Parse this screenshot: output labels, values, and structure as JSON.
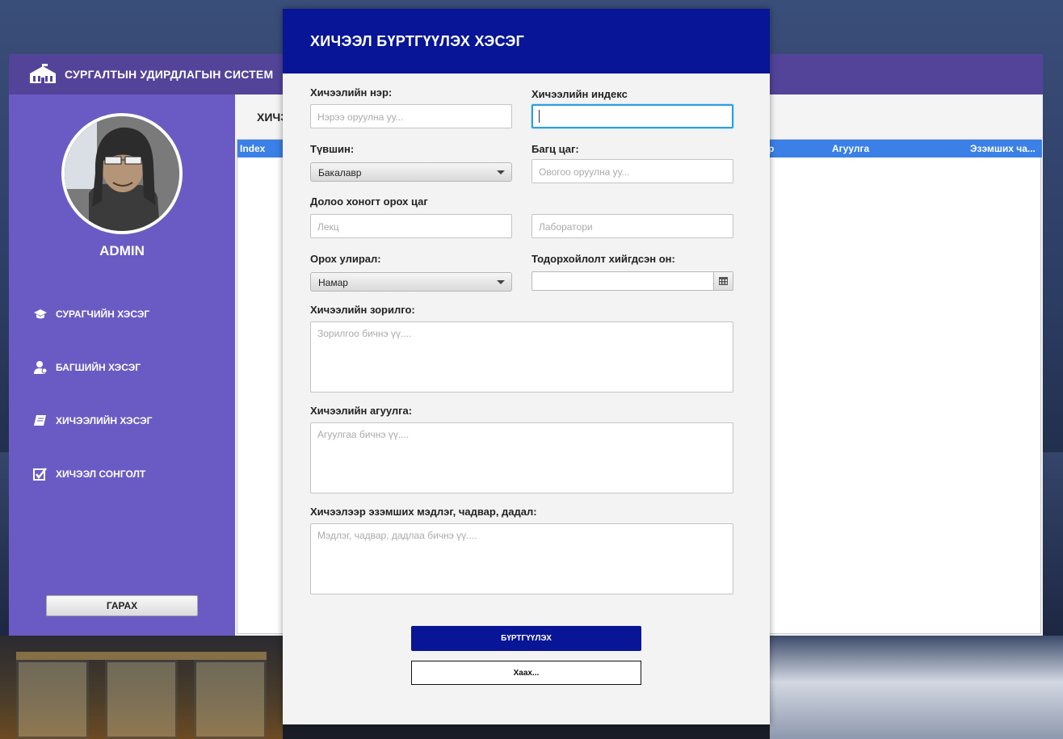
{
  "app": {
    "title": "СУРГАЛТЫН УДИРДЛАГЫН СИСТЕМ",
    "logo_icon": "school-building-icon"
  },
  "sidebar": {
    "user_name": "ADMIN",
    "items": [
      {
        "label": "СУРАГЧИЙН ХЭСЭГ",
        "icon": "graduation-cap-icon"
      },
      {
        "label": "БАГШИЙН ХЭСЭГ",
        "icon": "user-icon"
      },
      {
        "label": "ХИЧЭЭЛИЙН ХЭСЭГ",
        "icon": "book-icon"
      },
      {
        "label": "ХИЧЭЭЛ СОНГОЛТ",
        "icon": "checkbox-icon"
      }
    ],
    "logout_label": "ГАРАХ"
  },
  "content": {
    "title_visible": "ХИЧЭ",
    "table_headers": [
      "Index",
      "р",
      "Агуулга",
      "Эзэмших ча..."
    ]
  },
  "dialog": {
    "title": "ХИЧЭЭЛ БҮРТГҮҮЛЭХ ХЭСЭГ",
    "course_name_label": "Хичээлийн нэр:",
    "course_name_placeholder": "Нэрээ оруулна уу...",
    "course_index_label": "Хичээлийн индекс",
    "course_index_value": "",
    "level_label": "Түвшин:",
    "level_value": "Бакалавр",
    "credit_label": "Багц цаг:",
    "credit_placeholder": "Овогоо оруулна уу...",
    "weekly_hours_label": "Долоо хоногт орох цаг",
    "lecture_placeholder": "Лекц",
    "lab_placeholder": "Лаборатори",
    "semester_label": "Орох улирал:",
    "semester_value": "Намар",
    "year_label": "Тодорхойлолт хийгдсэн он:",
    "year_value": "",
    "objective_label": "Хичээлийн зорилго:",
    "objective_placeholder": "Зорилгоо бичнэ үү....",
    "contents_label": "Хичээлийн агуулга:",
    "contents_placeholder": "Агуулгаа бичнэ үү....",
    "skills_label": "Хичээлээр эзэмших мэдлэг, чадвар, дадал:",
    "skills_placeholder": "Мэдлэг, чадвар, дадлаа бичнэ үү....",
    "register_button": "БҮРТГҮҮЛЭХ",
    "close_button": "Хаах..."
  },
  "colors": {
    "sidebar": "#6a5bc4",
    "header": "#53449a",
    "dialog_header": "#071596",
    "table_header": "#3a80e6"
  }
}
